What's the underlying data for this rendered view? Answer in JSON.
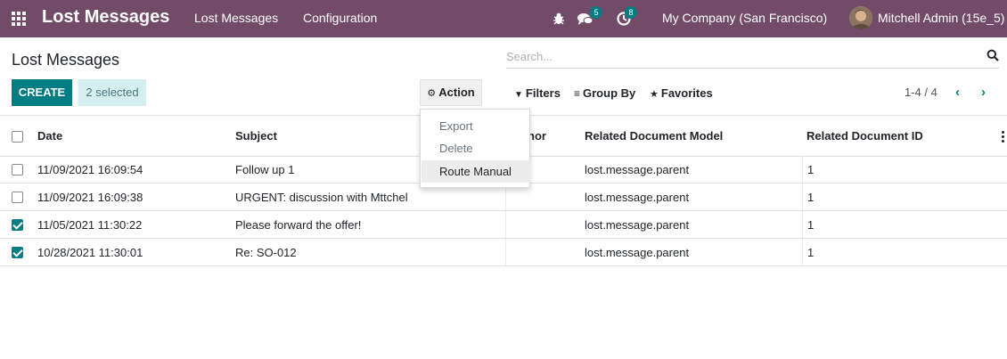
{
  "navbar": {
    "app_title": "Lost Messages",
    "menu": [
      "Lost Messages",
      "Configuration"
    ],
    "messages_count": "5",
    "activities_count": "8",
    "company": "My Company (San Francisco)",
    "user": "Mitchell Admin (15e_5)",
    "bg_color": "#714b67"
  },
  "control": {
    "title": "Lost Messages",
    "search_placeholder": "Search...",
    "create_label": "CREATE",
    "selected_label": "2 selected",
    "action_label": "Action",
    "filters_label": "Filters",
    "groupby_label": "Group By",
    "favorites_label": "Favorites",
    "pager": "1-4 / 4",
    "accent_color": "#017e84"
  },
  "action_menu": {
    "items": [
      "Export",
      "Delete",
      "Route Manual"
    ],
    "active": "Route Manual"
  },
  "table": {
    "columns": [
      "Date",
      "Subject",
      "Author",
      "Related Document Model",
      "Related Document ID"
    ],
    "author_header_visible": "hor",
    "rows": [
      {
        "checked": false,
        "date": "11/09/2021 16:09:54",
        "subject": "Follow up 1",
        "model": "lost.message.parent",
        "doc_id": "1"
      },
      {
        "checked": false,
        "date": "11/09/2021 16:09:38",
        "subject": "URGENT: discussion with Mttchel",
        "model": "lost.message.parent",
        "doc_id": "1"
      },
      {
        "checked": true,
        "date": "11/05/2021 11:30:22",
        "subject": "Please forward the offer!",
        "model": "lost.message.parent",
        "doc_id": "1"
      },
      {
        "checked": true,
        "date": "10/28/2021 11:30:01",
        "subject": "Re: SO-012",
        "model": "lost.message.parent",
        "doc_id": "1"
      }
    ]
  }
}
